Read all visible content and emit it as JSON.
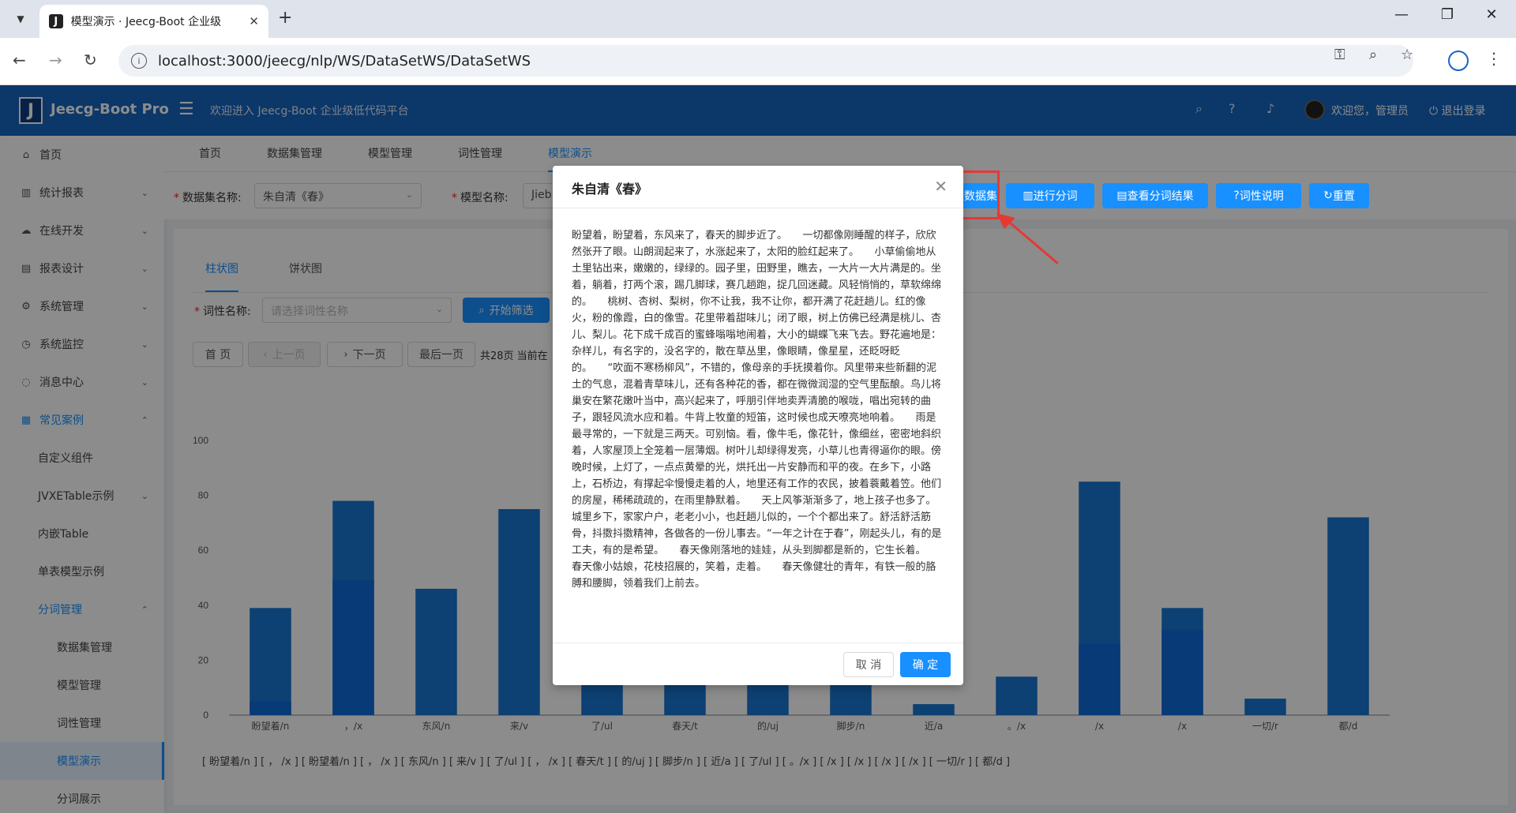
{
  "browser": {
    "tab_title": "模型演示 · Jeecg-Boot 企业级",
    "favicon_letter": "J",
    "url": "localhost:3000/jeecg/nlp/WS/DataSetWS/DataSetWS"
  },
  "header": {
    "logo_letter": "J",
    "app_name": "Jeecg-Boot Pro",
    "welcome": "欢迎进入 Jeecg-Boot 企业级低代码平台",
    "user_greeting": "欢迎您，管理员",
    "logout": "退出登录"
  },
  "sidebar": {
    "items": [
      {
        "label": "首页",
        "icon": "home-icon"
      },
      {
        "label": "统计报表",
        "icon": "bar-chart-icon"
      },
      {
        "label": "在线开发",
        "icon": "cloud-icon"
      },
      {
        "label": "报表设计",
        "icon": "report-icon"
      },
      {
        "label": "系统管理",
        "icon": "gear-icon"
      },
      {
        "label": "系统监控",
        "icon": "dashboard-icon"
      },
      {
        "label": "消息中心",
        "icon": "message-icon"
      },
      {
        "label": "常见案例",
        "icon": "appstore-icon"
      },
      {
        "label": "自定义组件"
      },
      {
        "label": "JVXETable示例"
      },
      {
        "label": "内嵌Table"
      },
      {
        "label": "单表模型示例"
      },
      {
        "label": "分词管理"
      },
      {
        "label": "数据集管理"
      },
      {
        "label": "模型管理"
      },
      {
        "label": "词性管理"
      },
      {
        "label": "模型演示"
      },
      {
        "label": "分词展示"
      }
    ]
  },
  "page_tabs": [
    "首页",
    "数据集管理",
    "模型管理",
    "词性管理",
    "模型演示"
  ],
  "filters": {
    "dataset_label": "数据集名称:",
    "dataset_value": "朱自清《春》",
    "model_label": "模型名称:",
    "model_value": "Jieb",
    "buttons": {
      "view_dataset": "数据集",
      "segment": "进行分词",
      "view_result": "查看分词结果",
      "pos_desc": "词性说明",
      "reset": "重置"
    }
  },
  "card": {
    "tabs": [
      "柱状图",
      "饼状图"
    ],
    "pos_label": "词性名称:",
    "pos_placeholder": "请选择词性名称",
    "filter_button": "开始筛选",
    "pager": {
      "first": "首 页",
      "prev": "上一页",
      "next": "下一页",
      "last": "最后一页",
      "info": "共28页 当前在"
    },
    "words_line": "[ 盼望着/n ] [ ， /x ] [ 盼望着/n ] [ ， /x ] [ 东风/n ] [ 来/v ] [ 了/ul ] [ ， /x ] [ 春天/t ] [ 的/uj ] [ 脚步/n ] [ 近/a ] [ 了/ul ] [ 。/x ] [ /x ] [ /x ] [    /x ] [    /x ] [ 一切/r ] [ 都/d ]"
  },
  "chart_data": {
    "type": "bar",
    "categories": [
      "盼望着/n",
      "，/x",
      "东风/n",
      "来/v",
      "了/ul",
      "春天/t",
      "的/uj",
      "脚步/n",
      "近/a",
      "。/x",
      "/x",
      "/x",
      "一切/r",
      "都/d"
    ],
    "values": [
      39,
      78,
      46,
      75,
      45,
      40,
      60,
      44,
      4,
      14,
      85,
      39,
      6,
      72
    ],
    "inner_values": [
      5,
      49,
      0,
      0,
      0,
      0,
      0,
      0,
      0,
      0,
      26,
      31,
      0,
      0
    ],
    "ylim": [
      0,
      100
    ],
    "yticks": [
      0,
      20,
      40,
      60,
      80,
      100
    ],
    "color": "#1976d2",
    "inner_color": "#0d6ad8",
    "grid": false
  },
  "modal": {
    "title": "朱自清《春》",
    "body": "盼望着，盼望着，东风来了，春天的脚步近了。　　一切都像刚睡醒的样子，欣欣然张开了眼。山朗润起来了，水涨起来了，太阳的脸红起来了。　　小草偷偷地从土里钻出来，嫩嫩的，绿绿的。园子里，田野里，瞧去，一大片一大片满是的。坐着，躺着，打两个滚，踢几脚球，赛几趟跑，捉几回迷藏。风轻悄悄的，草软绵绵的。　　桃树、杏树、梨树，你不让我，我不让你，都开满了花赶趟儿。红的像火，粉的像霞，白的像雪。花里带着甜味儿；闭了眼，树上仿佛已经满是桃儿、杏儿、梨儿。花下成千成百的蜜蜂嗡嗡地闹着，大小的蝴蝶飞来飞去。野花遍地是：杂样儿，有名字的，没名字的，散在草丛里，像眼睛，像星星，还眨呀眨的。　　“吹面不寒杨柳风”，不错的，像母亲的手抚摸着你。风里带来些新翻的泥土的气息，混着青草味儿，还有各种花的香，都在微微润湿的空气里酝酿。鸟儿将巢安在繁花嫩叶当中，高兴起来了，呼朋引伴地卖弄清脆的喉咙，唱出宛转的曲子，跟轻风流水应和着。牛背上牧童的短笛，这时候也成天嘹亮地响着。　　雨是最寻常的，一下就是三两天。可别恼。看，像牛毛，像花针，像细丝，密密地斜织着，人家屋顶上全笼着一层薄烟。树叶儿却绿得发亮，小草儿也青得逼你的眼。傍晚时候，上灯了，一点点黄晕的光，烘托出一片安静而和平的夜。在乡下，小路上，石桥边，有撑起伞慢慢走着的人，地里还有工作的农民，披着蓑戴着笠。他们的房屋，稀稀疏疏的，在雨里静默着。　　天上风筝渐渐多了，地上孩子也多了。城里乡下，家家户户，老老小小，也赶趟儿似的，一个个都出来了。舒活舒活筋骨，抖擞抖擞精神，各做各的一份儿事去。“一年之计在于春”，刚起头儿，有的是工夫，有的是希望。　　春天像刚落地的娃娃，从头到脚都是新的，它生长着。　　春天像小姑娘，花枝招展的，笑着，走着。　　春天像健壮的青年，有铁一般的胳膊和腰脚，领着我们上前去。",
    "cancel": "取 消",
    "ok": "确 定"
  }
}
